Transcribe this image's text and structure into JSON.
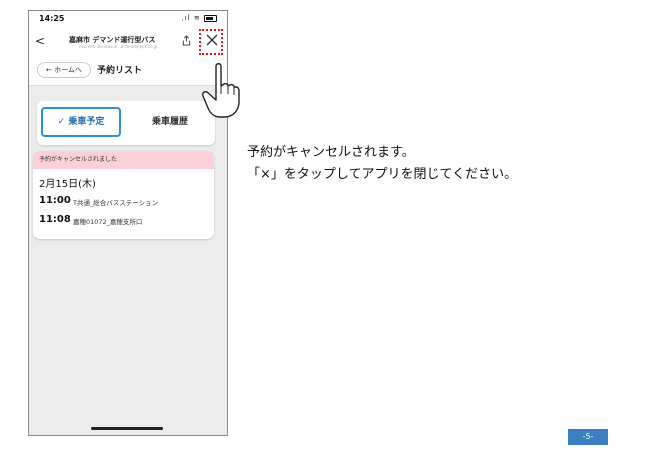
{
  "phone": {
    "status": {
      "time": "14:25",
      "signal": ".ıl"
    },
    "nav": {
      "back": "<",
      "title": "嘉麻市 デマンド運行型バス",
      "url": "micmeti-life-ikasue...ochmotejhos.co.jp"
    },
    "subheader": {
      "home": "← ホームへ",
      "title": "予約リスト"
    },
    "segments": {
      "upcoming": "✓ 乗車予定",
      "history": "乗車履歴"
    },
    "reservation": {
      "banner": "予約がキャンセルされました",
      "date": "2月15日(木)",
      "departure_time": "11:00",
      "departure_stop": "T共通_総合バスステーション",
      "connector": "◦",
      "arrival_time": "11:08",
      "arrival_stop": "嘉穂01072_嘉穂支所口"
    }
  },
  "instructions": {
    "line1": "予約がキャンセルされます。",
    "line2": "「×」をタップしてアプリを閉じてください。"
  },
  "page_number": "-5-",
  "colors": {
    "accent": "#2d8fd5",
    "banner": "#fbd0d8",
    "highlight": "#e01818",
    "page_badge": "#3a7ec4"
  }
}
